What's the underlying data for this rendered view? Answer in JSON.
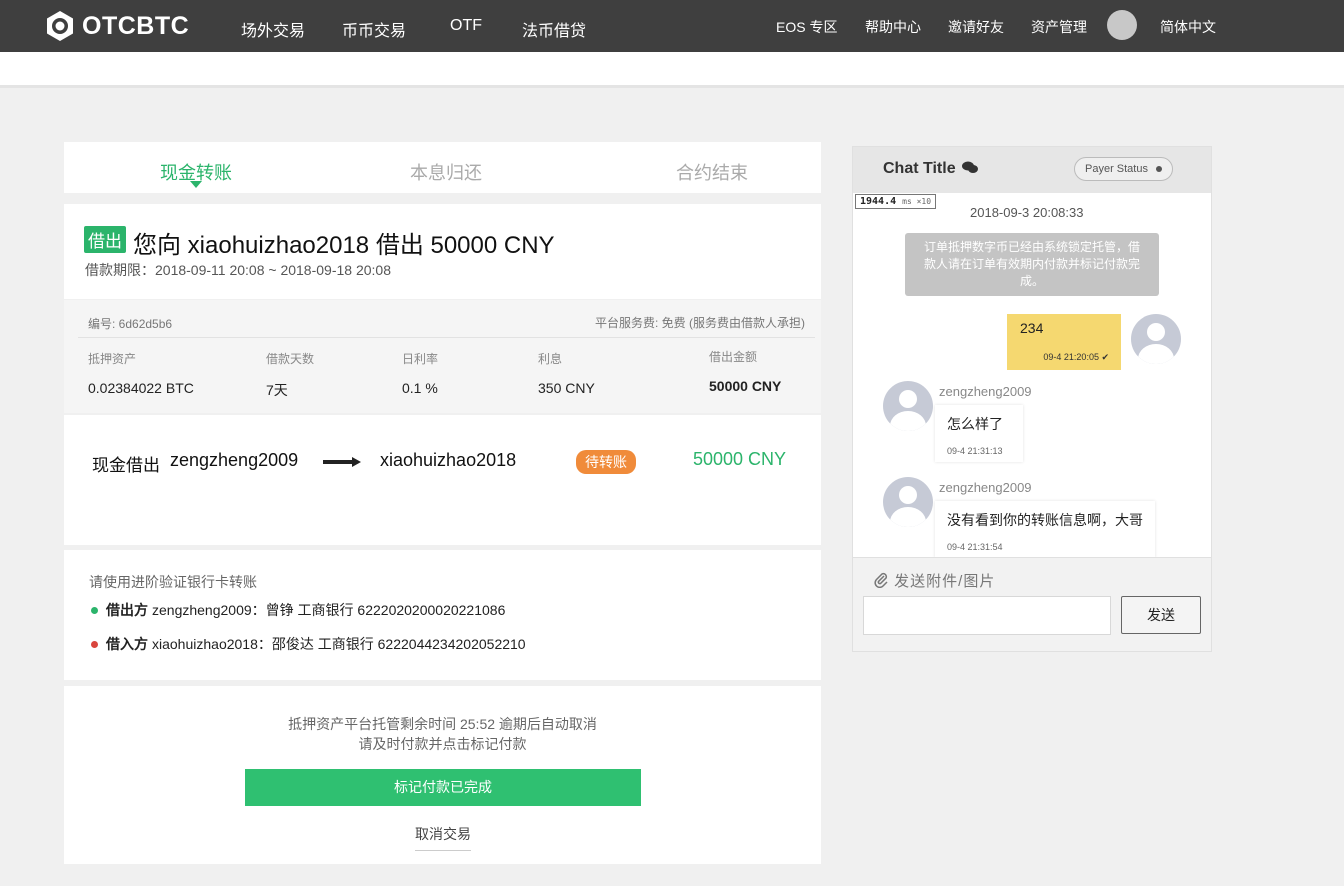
{
  "nav": {
    "brand": "OTCBTC",
    "items": [
      "场外交易",
      "币币交易",
      "OTF",
      "法币借贷"
    ],
    "right": [
      "EOS 专区",
      "帮助中心",
      "邀请好友",
      "资产管理"
    ],
    "language": "简体中文"
  },
  "tabs": [
    "现金转账",
    "本息归还",
    "合约结束"
  ],
  "headline": {
    "badge": "借出",
    "text": "您向 xiaohuizhao2018 借出 50000 CNY",
    "period": "借款期限：2018-09-11 20:08 ~ 2018-09-18 20:08"
  },
  "details": {
    "id": "编号: 6d62d5b6",
    "fee": "平台服务费:   免费 (服务费由借款人承担)",
    "cols": [
      {
        "label": "抵押资产",
        "value": "0.02384022 BTC"
      },
      {
        "label": "借款天数",
        "value": "7天"
      },
      {
        "label": "日利率",
        "value": "0.1 %"
      },
      {
        "label": "利息",
        "value": "350 CNY"
      },
      {
        "label": "借出金额",
        "value": "50000 CNY"
      }
    ]
  },
  "flow": {
    "title": "现金借出",
    "from": "zengzheng2009",
    "to": "xiaohuizhao2018",
    "status": "待转账",
    "amount": "50000 CNY"
  },
  "bank": {
    "hint": "请使用进阶验证银行卡转账",
    "lender_label": "借出方",
    "lender_text": "zengzheng2009：曾铮 工商银行 6222020200020221086",
    "borrower_label": "借入方",
    "borrower_text": "xiaohuizhao2018：邵俊达 工商银行 6222044234202052210",
    "lender_color": "#2bb46b",
    "borrower_color": "#d9453d"
  },
  "action": {
    "timer_line1": "抵押资产平台托管剩余时间 25:52 逾期后自动取消",
    "timer_line2": "请及时付款并点击标记付款",
    "mark_button": "标记付款已完成",
    "cancel": "取消交易"
  },
  "chat": {
    "title": "Chat Title",
    "payer_status": "Payer Status",
    "perf": "1944.4",
    "perf_unit": "ms ×10",
    "date": "2018-09-3 20:08:33",
    "system_message": "订单抵押数字币已经由系统锁定托管，借款人请在订单有效期内付款并标记付款完成。",
    "mine": {
      "text": "234",
      "time": "09-4 21:20:05 ✔"
    },
    "peer": [
      {
        "name": "zengzheng2009",
        "text": "怎么样了",
        "time": "09-4 21:31:13"
      },
      {
        "name": "zengzheng2009",
        "text": "没有看到你的转账信息啊，大哥",
        "time": "09-4 21:31:54"
      }
    ],
    "attach": "发送附件/图片",
    "send": "发送"
  }
}
